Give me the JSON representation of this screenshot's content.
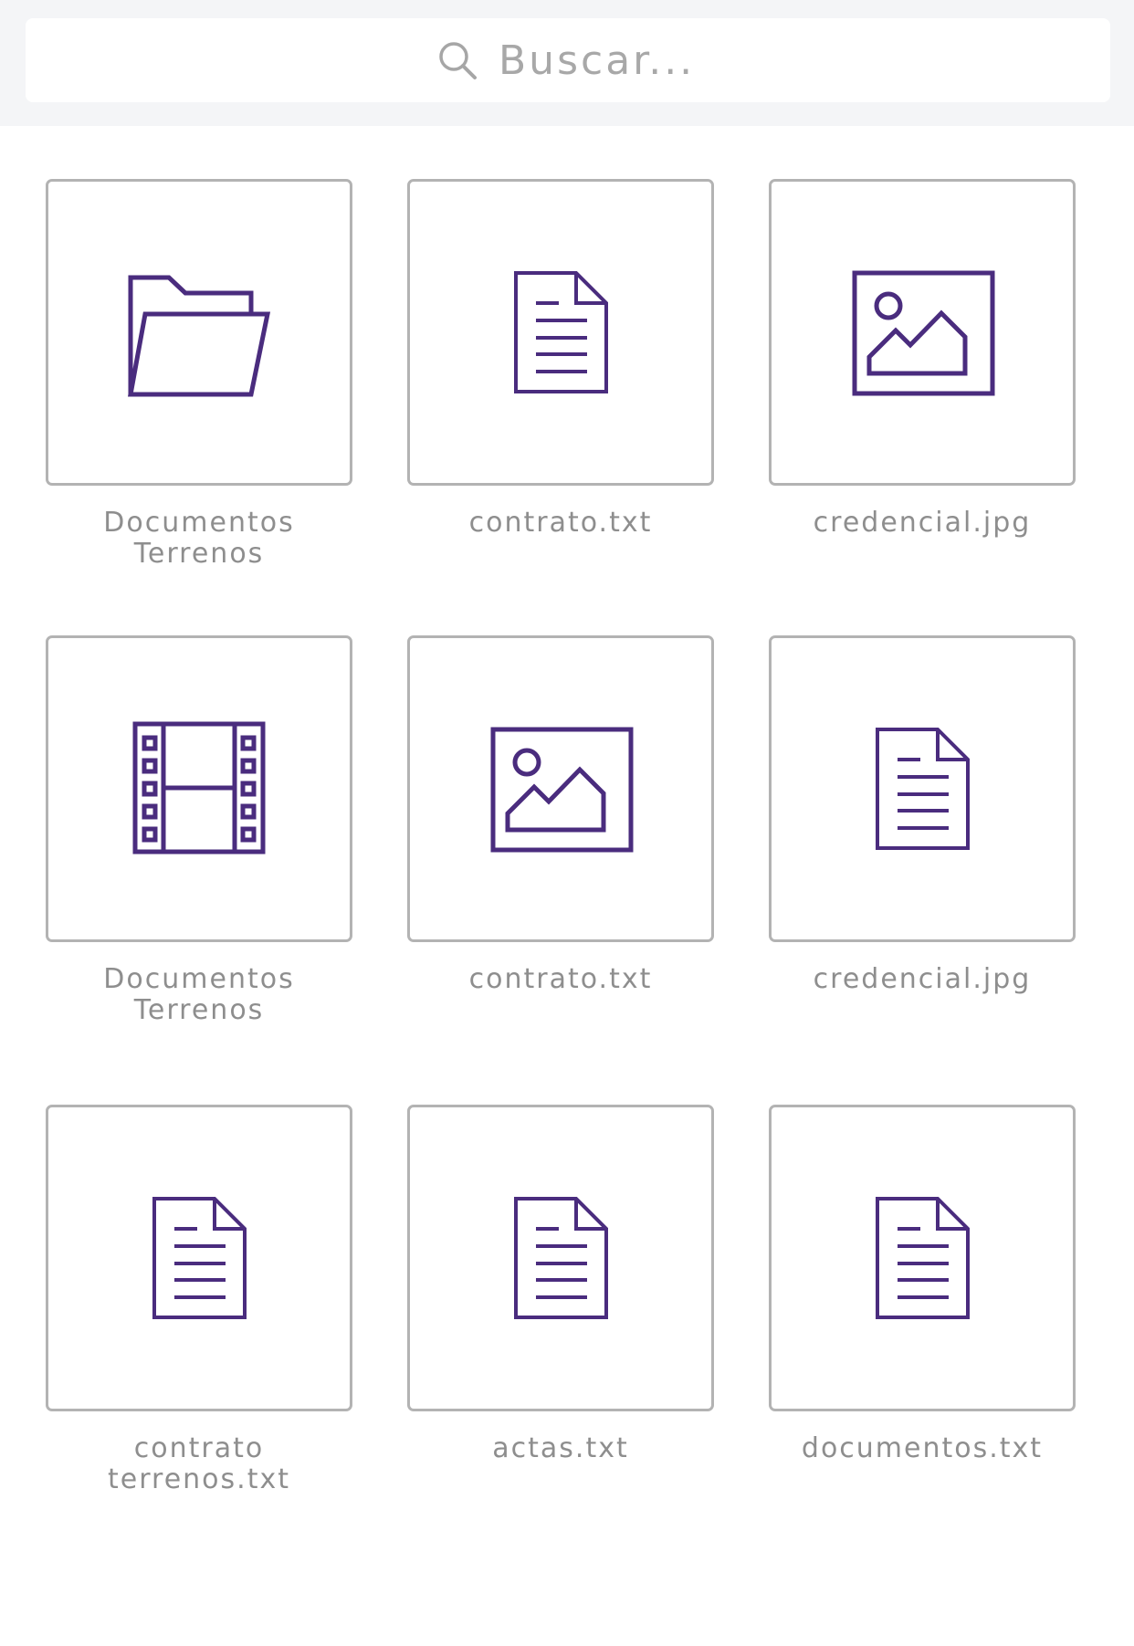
{
  "search": {
    "placeholder": "Buscar...",
    "icon": "search-icon"
  },
  "colors": {
    "icon_stroke": "#4a2c7e",
    "tile_border": "#b3b3b3",
    "label_text": "#8e8e8e",
    "search_area_bg": "#f4f5f7"
  },
  "files": [
    {
      "label": "Documentos\nTerrenos",
      "icon": "folder-icon"
    },
    {
      "label": "contrato.txt",
      "icon": "document-icon"
    },
    {
      "label": "credencial.jpg",
      "icon": "image-icon"
    },
    {
      "label": "Documentos\nTerrenos",
      "icon": "video-icon"
    },
    {
      "label": "contrato.txt",
      "icon": "image-icon"
    },
    {
      "label": "credencial.jpg",
      "icon": "document-icon"
    },
    {
      "label": "contrato\nterrenos.txt",
      "icon": "document-icon"
    },
    {
      "label": "actas.txt",
      "icon": "document-icon"
    },
    {
      "label": "documentos.txt",
      "icon": "document-icon"
    }
  ]
}
